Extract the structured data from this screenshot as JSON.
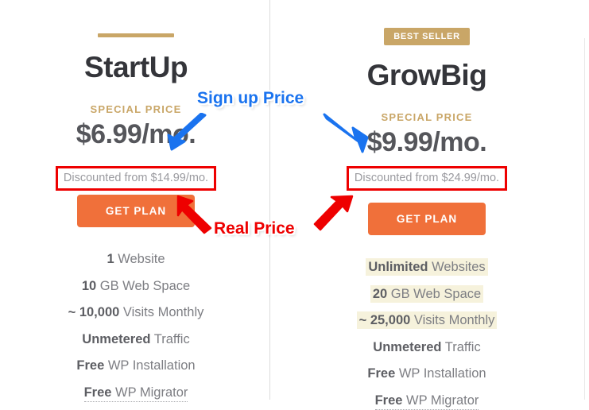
{
  "page": {
    "divider_color": "#dcdcdc",
    "background": "#ffffff"
  },
  "plans": [
    {
      "id": "startup",
      "accent_color": "#c9a667",
      "badge": null,
      "name": "StartUp",
      "special_price_label": "SPECIAL PRICE",
      "price": "$6.99/mo.",
      "old_price": "Discounted from $14.99/mo.",
      "old_price_box_color": "#ee0000",
      "cta_label": "GET PLAN",
      "cta_color": "#f0703a",
      "features": [
        {
          "emph": "1",
          "rest": " Website",
          "highlight": false,
          "dotted": false
        },
        {
          "emph": "10",
          "rest": " GB Web Space",
          "highlight": false,
          "dotted": false
        },
        {
          "emph": "~ 10,000",
          "rest": " Visits Monthly",
          "highlight": false,
          "dotted": false
        },
        {
          "emph": "Unmetered",
          "rest": " Traffic",
          "highlight": false,
          "dotted": false
        },
        {
          "emph": "Free",
          "rest": " WP Installation",
          "highlight": false,
          "dotted": false
        },
        {
          "emph": "Free",
          "rest": " WP Migrator",
          "highlight": false,
          "dotted": true
        }
      ]
    },
    {
      "id": "growbig",
      "accent_color": "#c9a667",
      "badge": "BEST SELLER",
      "name": "GrowBig",
      "special_price_label": "SPECIAL PRICE",
      "price": "$9.99/mo.",
      "old_price": "Discounted from $24.99/mo.",
      "old_price_box_color": "#ee0000",
      "cta_label": "GET PLAN",
      "cta_color": "#f0703a",
      "features": [
        {
          "emph": "Unlimited",
          "rest": " Websites",
          "highlight": true,
          "dotted": false
        },
        {
          "emph": "20",
          "rest": " GB Web Space",
          "highlight": true,
          "dotted": false
        },
        {
          "emph": "~ 25,000",
          "rest": " Visits Monthly",
          "highlight": true,
          "dotted": false
        },
        {
          "emph": "Unmetered",
          "rest": " Traffic",
          "highlight": false,
          "dotted": false
        },
        {
          "emph": "Free",
          "rest": " WP Installation",
          "highlight": false,
          "dotted": false
        },
        {
          "emph": "Free",
          "rest": " WP Migrator",
          "highlight": false,
          "dotted": true
        }
      ]
    }
  ],
  "annotations": {
    "signup_label": "Sign up Price",
    "signup_color": "#1a73ef",
    "real_label": "Real Price",
    "real_color": "#ee0000"
  }
}
